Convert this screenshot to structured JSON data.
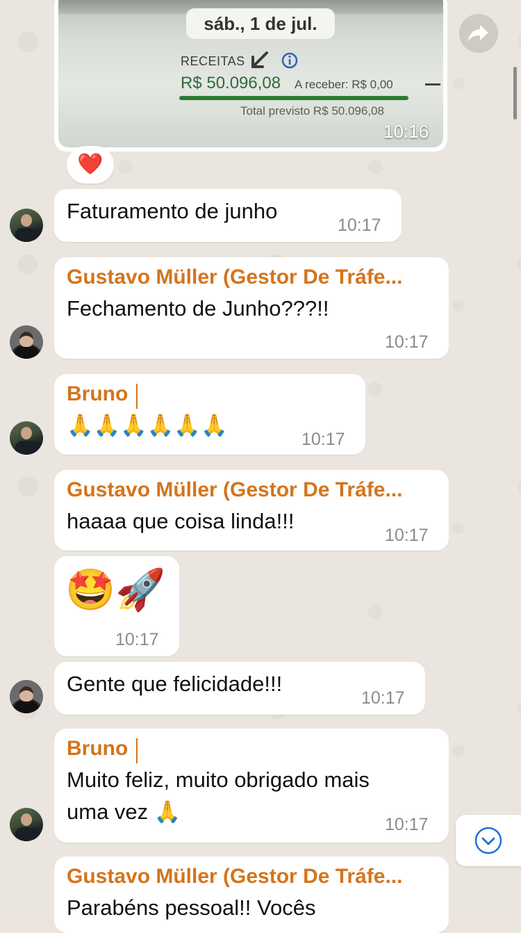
{
  "image_message": {
    "date_chip": "sáb., 1 de jul.",
    "receitas_label": "RECEITAS",
    "amount": "R$ 50.096,08",
    "a_receber": "A receber: R$ 0,00",
    "total_previsto": "Total previsto R$ 50.096,08",
    "time": "10:16",
    "reaction": "❤️"
  },
  "messages": [
    {
      "text": "Faturamento de junho",
      "time": "10:17"
    },
    {
      "sender": "Gustavo Müller (Gestor De Tráfe...",
      "text": "Fechamento de Junho???!!",
      "time": "10:17"
    },
    {
      "sender": "Bruno",
      "text": "🙏🙏🙏🙏🙏🙏",
      "time": "10:17"
    },
    {
      "sender": "Gustavo Müller (Gestor De Tráfe...",
      "text": "haaaa que coisa linda!!!",
      "time": "10:17"
    },
    {
      "text": "🤩🚀",
      "time": "10:17"
    },
    {
      "text": "Gente que felicidade!!!",
      "time": "10:17"
    },
    {
      "sender": "Bruno",
      "text_line1": "Muito feliz, muito obrigado mais",
      "text_line2": "uma vez 🙏",
      "time": "10:17"
    },
    {
      "sender": "Gustavo Müller (Gestor De Tráfe...",
      "text": "Parabéns pessoal!! Vocês"
    }
  ],
  "colors": {
    "sender": "#d4741c",
    "bubble": "#ffffff",
    "background": "#eae6df",
    "accent_blue": "#1d6fd6"
  },
  "icons": [
    "forward-icon",
    "scroll-down-icon",
    "info-icon",
    "arrow-down-left-icon"
  ]
}
